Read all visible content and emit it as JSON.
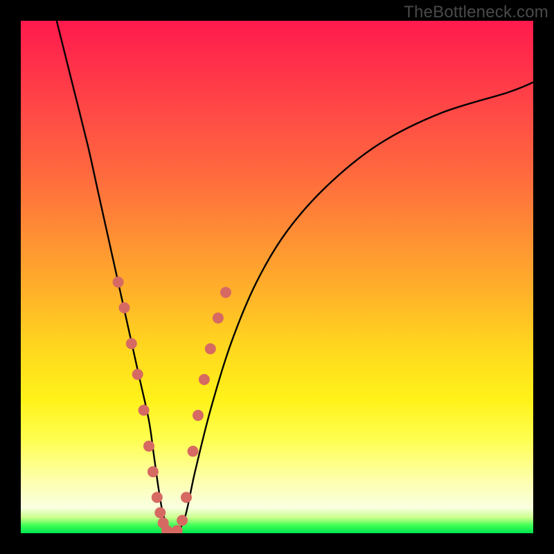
{
  "watermark": "TheBottleneck.com",
  "chart_data": {
    "type": "line",
    "title": "",
    "xlabel": "",
    "ylabel": "",
    "xlim": [
      0,
      100
    ],
    "ylim": [
      0,
      100
    ],
    "series": [
      {
        "name": "bottleneck-curve",
        "x": [
          7,
          10,
          13,
          15,
          17,
          19,
          21,
          23,
          25,
          26,
          27,
          28,
          30,
          32,
          34,
          37,
          41,
          46,
          52,
          60,
          70,
          82,
          95,
          100
        ],
        "values": [
          100,
          88,
          76,
          67,
          58,
          49,
          40,
          31,
          22,
          15,
          8,
          3,
          0,
          3,
          12,
          24,
          37,
          49,
          59,
          68,
          76,
          82,
          86,
          88
        ]
      }
    ],
    "markers": {
      "name": "highlight-dots",
      "color": "#d66a62",
      "x": [
        19.0,
        20.2,
        21.6,
        22.8,
        24.0,
        25.0,
        25.8,
        26.6,
        27.2,
        27.8,
        28.5,
        29.5,
        30.5,
        31.5,
        32.3,
        33.6,
        34.6,
        35.8,
        37.0,
        38.5,
        40.0
      ],
      "values": [
        49.0,
        44.0,
        37.0,
        31.0,
        24.0,
        17.0,
        12.0,
        7.0,
        4.0,
        2.0,
        0.5,
        0.0,
        0.5,
        2.5,
        7.0,
        16.0,
        23.0,
        30.0,
        36.0,
        42.0,
        47.0
      ]
    },
    "gradient_meaning": "vertical color scale: red (top, high bottleneck) to green (bottom, no bottleneck)"
  }
}
